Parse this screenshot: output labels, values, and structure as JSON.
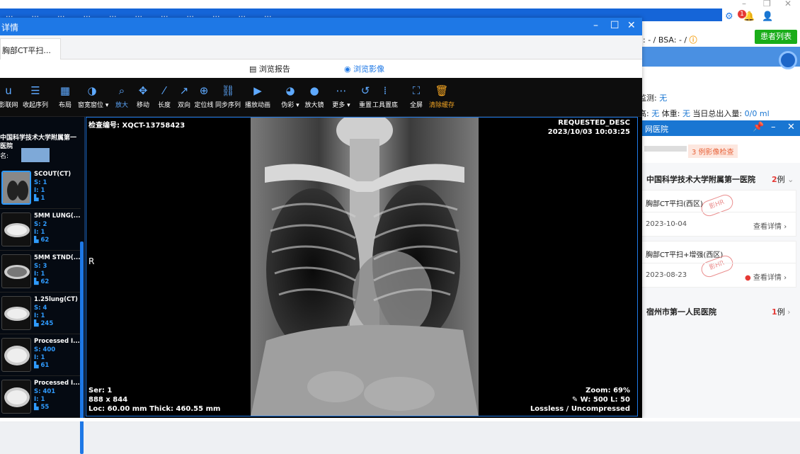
{
  "app": {
    "menu": [
      "...",
      "...",
      "...",
      "...",
      "...",
      "...",
      "...",
      "...",
      "...",
      "...",
      "..."
    ]
  },
  "window_controls": {
    "minimize": "–",
    "restore": "❐",
    "close": "✕"
  },
  "notifications": {
    "count": "1"
  },
  "right_panel": {
    "bsa": ": - / BSA: - /",
    "patient_list_button": "患者列表",
    "monitor_label": "监测:",
    "monitor_value": "无",
    "height_label": "高:",
    "height_value": "无",
    "weight_label": "体重:",
    "weight_value": "无",
    "intake_label": "当日总出入量:",
    "intake_value": "0/0 ml",
    "net_hospital_title": "网医院",
    "pin": "📌",
    "minimize": "–",
    "close": "✕",
    "exam_badge": "3 例影像检查",
    "hospitals": [
      {
        "name": "中国科学技术大学附属第一医院",
        "count": "2",
        "unit": "例"
      },
      {
        "name": "宿州市第一人民医院",
        "count": "1",
        "unit": "例"
      }
    ],
    "records": [
      {
        "title": "胸部CT平扫(西区)",
        "date": "2023-10-04",
        "action": "查看详情"
      },
      {
        "title": "胸部CT平扫+增强(西区)",
        "date": "2023-08-23",
        "action": "查看详情"
      }
    ],
    "stamp_text": "影HR"
  },
  "modal": {
    "title": "详情",
    "tab": "胸部CT平扫...",
    "subtabs": {
      "report": "浏览报告",
      "images": "浏览影像"
    }
  },
  "toolbar": [
    {
      "icon": "u",
      "label": "影联网"
    },
    {
      "icon": "☰",
      "label": "收起序列"
    },
    {
      "icon": "▦",
      "label": "布局"
    },
    {
      "icon": "◑",
      "label": "窗宽窗位 ▾"
    },
    {
      "icon": "⌕",
      "label": "放大"
    },
    {
      "icon": "✥",
      "label": "移动"
    },
    {
      "icon": "⁄",
      "label": "长度"
    },
    {
      "icon": "↗",
      "label": "双向"
    },
    {
      "icon": "⊕",
      "label": "定位线"
    },
    {
      "icon": "⛓",
      "label": "同步序列"
    },
    {
      "icon": "▶",
      "label": "播放动画"
    },
    {
      "icon": "◕",
      "label": "伪彩 ▾"
    },
    {
      "icon": "●",
      "label": "放大镜"
    },
    {
      "icon": "⋯",
      "label": "更多 ▾"
    },
    {
      "icon": "↺",
      "label": "重置"
    },
    {
      "icon": "⁞",
      "label": "工具置底"
    },
    {
      "icon": "⛶",
      "label": "全屏"
    },
    {
      "icon": "🗑",
      "label": "清除缓存"
    }
  ],
  "series_panel": {
    "hospital": "中国科学技术大学附属第一医院",
    "name_label": "名:",
    "series": [
      {
        "name": "SCOUT(CT)",
        "s": "S: 1",
        "i": "I: 1",
        "count": "1"
      },
      {
        "name": "5MM LUNG(...",
        "s": "S: 2",
        "i": "I: 1",
        "count": "62"
      },
      {
        "name": "5MM STND(...",
        "s": "S: 3",
        "i": "I: 1",
        "count": "62"
      },
      {
        "name": "1.25lung(CT)",
        "s": "S: 4",
        "i": "I: 1",
        "count": "245"
      },
      {
        "name": "Processed I...",
        "s": "S: 400",
        "i": "I: 1",
        "count": "61"
      },
      {
        "name": "Processed I...",
        "s": "S: 401",
        "i": "I: 1",
        "count": "55"
      }
    ]
  },
  "overlay": {
    "exam_id": "检查编号: XQCT-13758423",
    "requested": "REQUESTED_DESC",
    "datetime": "2023/10/03 10:03:25",
    "orientation": "R",
    "ser": "Ser: 1",
    "dims": "888 x 844",
    "loc": "Loc: 60.00 mm Thick: 460.55 mm",
    "zoom": "Zoom: 69%",
    "wl": "✎ W: 500 L: 50",
    "compression": "Lossless / Uncompressed"
  },
  "colors": {
    "primary": "#1e78e6",
    "green": "#1aad19",
    "orange": "#f5a623",
    "red": "#e53935"
  }
}
